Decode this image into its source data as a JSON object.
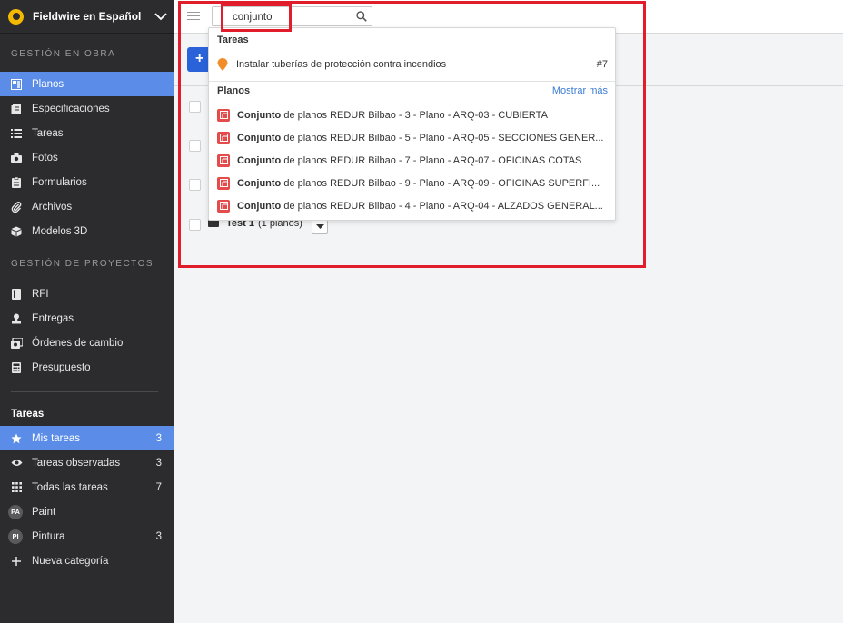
{
  "sidebar": {
    "project_name": "Fieldwire en Español",
    "section_obra": "GESTIÓN EN OBRA",
    "obra_items": [
      {
        "label": "Planos",
        "icon": "plans-icon",
        "active": true
      },
      {
        "label": "Especificaciones",
        "icon": "specs-icon"
      },
      {
        "label": "Tareas",
        "icon": "list-icon"
      },
      {
        "label": "Fotos",
        "icon": "camera-icon"
      },
      {
        "label": "Formularios",
        "icon": "clipboard-icon"
      },
      {
        "label": "Archivos",
        "icon": "paperclip-icon"
      },
      {
        "label": "Modelos 3D",
        "icon": "cube-icon"
      }
    ],
    "section_proyectos": "GESTIÓN DE PROYECTOS",
    "proyecto_items": [
      {
        "label": "RFI",
        "icon": "rfi-icon"
      },
      {
        "label": "Entregas",
        "icon": "person-stamp-icon"
      },
      {
        "label": "Órdenes de cambio",
        "icon": "change-order-icon"
      },
      {
        "label": "Presupuesto",
        "icon": "calculator-icon"
      }
    ],
    "tareas_heading": "Tareas",
    "tareas_items": [
      {
        "label": "Mis tareas",
        "icon": "star-icon",
        "count": "3",
        "active": true
      },
      {
        "label": "Tareas observadas",
        "icon": "eye-icon",
        "count": "3"
      },
      {
        "label": "Todas las tareas",
        "icon": "grid-icon",
        "count": "7"
      },
      {
        "label": "Paint",
        "badge": "PA",
        "count": ""
      },
      {
        "label": "Pintura",
        "badge": "PI",
        "count": "3"
      },
      {
        "label": "Nueva categoría",
        "icon": "plus-icon",
        "count": ""
      }
    ]
  },
  "search": {
    "value": "conjunto",
    "icon": "search-icon"
  },
  "main": {
    "add_label": "+",
    "folder_name": "Test 1",
    "folder_count": "(1 planos)"
  },
  "results": {
    "tasks_title": "Tareas",
    "task": {
      "title": "Instalar tuberías de protección contra incendios",
      "number": "#7"
    },
    "plans_title": "Planos",
    "show_more": "Mostrar más",
    "plans": [
      {
        "highlight": "Conjunto",
        "rest": " de planos REDUR Bilbao - 3 - Plano - ARQ-03 - CUBIERTA"
      },
      {
        "highlight": "Conjunto",
        "rest": " de planos REDUR Bilbao - 5 - Plano - ARQ-05 - SECCIONES GENER..."
      },
      {
        "highlight": "Conjunto",
        "rest": " de planos REDUR Bilbao - 7 - Plano - ARQ-07 - OFICINAS COTAS"
      },
      {
        "highlight": "Conjunto",
        "rest": " de planos REDUR Bilbao - 9 - Plano - ARQ-09 - OFICINAS SUPERFI..."
      },
      {
        "highlight": "Conjunto",
        "rest": " de planos REDUR Bilbao - 4 - Plano - ARQ-04 - ALZADOS GENERAL..."
      }
    ]
  },
  "colors": {
    "accent": "#5b8de8",
    "annotation": "#e11d2b",
    "task_pin": "#f28c28",
    "plan_icon": "#e44b4b"
  }
}
